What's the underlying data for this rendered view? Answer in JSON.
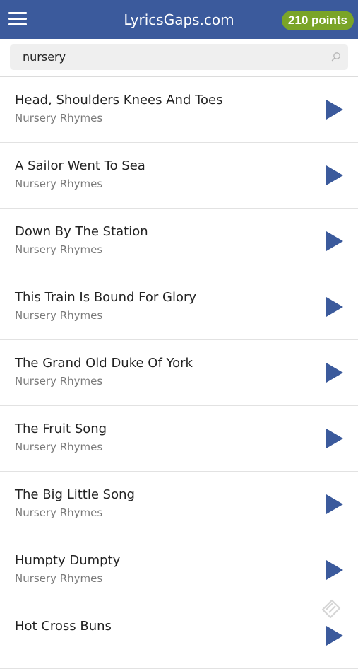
{
  "header": {
    "title": "LyricsGaps.com",
    "points": "210 points",
    "menu_icon": "hamburger-menu-icon"
  },
  "search": {
    "value": "nursery",
    "icon": "search-icon"
  },
  "songs": [
    {
      "title": "Head, Shoulders Knees And Toes",
      "category": "Nursery Rhymes"
    },
    {
      "title": "A Sailor Went To Sea",
      "category": "Nursery Rhymes"
    },
    {
      "title": "Down By The Station",
      "category": "Nursery Rhymes"
    },
    {
      "title": "This Train Is Bound For Glory",
      "category": "Nursery Rhymes"
    },
    {
      "title": "The Grand Old Duke Of York",
      "category": "Nursery Rhymes"
    },
    {
      "title": "The Fruit Song",
      "category": "Nursery Rhymes"
    },
    {
      "title": "The Big Little Song",
      "category": "Nursery Rhymes"
    },
    {
      "title": "Humpty Dumpty",
      "category": "Nursery Rhymes"
    },
    {
      "title": "Hot Cross Buns",
      "category": ""
    }
  ],
  "colors": {
    "header": "#3b5a9c",
    "badge": "#7aa428",
    "play": "#3b5a9c"
  }
}
